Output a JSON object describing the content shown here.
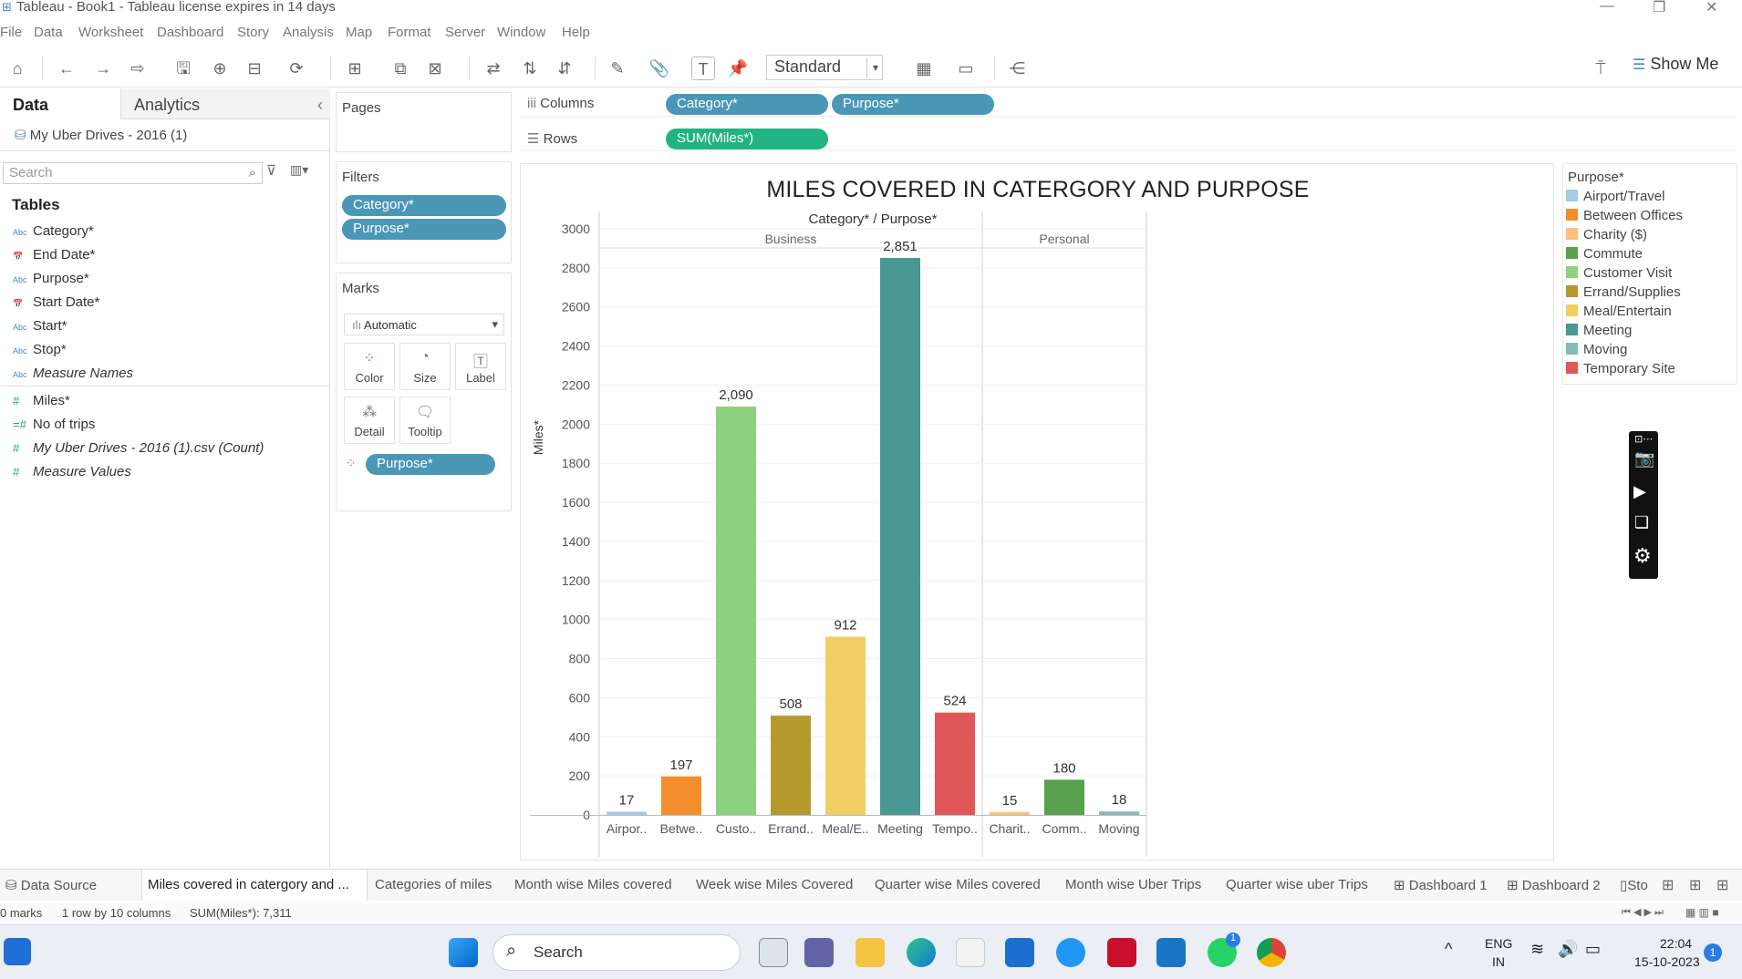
{
  "window": {
    "title": "Tableau - Book1 - Tableau license expires in 14 days"
  },
  "menu": [
    "File",
    "Data",
    "Worksheet",
    "Dashboard",
    "Story",
    "Analysis",
    "Map",
    "Format",
    "Server",
    "Window",
    "Help"
  ],
  "toolbar": {
    "fit_mode": "Standard",
    "show_me": "Show Me"
  },
  "left_pane": {
    "tabs": [
      "Data",
      "Analytics"
    ],
    "datasource": "My Uber Drives - 2016 (1)",
    "search_placeholder": "Search",
    "tables_heading": "Tables",
    "dimensions": [
      {
        "type": "Abc",
        "name": "Category*"
      },
      {
        "type": "date",
        "name": "End Date*"
      },
      {
        "type": "Abc",
        "name": "Purpose*"
      },
      {
        "type": "date",
        "name": "Start Date*"
      },
      {
        "type": "Abc",
        "name": "Start*"
      },
      {
        "type": "Abc",
        "name": "Stop*"
      },
      {
        "type": "Abc",
        "name": "Measure Names"
      }
    ],
    "measures": [
      {
        "type": "#",
        "name": "Miles*"
      },
      {
        "type": "=#",
        "name": "No of trips"
      },
      {
        "type": "#",
        "name": "My Uber Drives - 2016 (1).csv (Count)"
      },
      {
        "type": "#",
        "name": "Measure Values"
      }
    ]
  },
  "pages": {
    "title": "Pages"
  },
  "filters": {
    "title": "Filters",
    "pills": [
      "Category*",
      "Purpose*"
    ]
  },
  "marks": {
    "title": "Marks",
    "type": "Automatic",
    "buttons": [
      "Color",
      "Size",
      "Label",
      "Detail",
      "Tooltip"
    ],
    "color_pill": "Purpose*"
  },
  "shelves": {
    "columns_label": "Columns",
    "columns": [
      "Category*",
      "Purpose*"
    ],
    "rows_label": "Rows",
    "rows": [
      "SUM(Miles*)"
    ]
  },
  "chart_data": {
    "type": "bar",
    "title": "MILES COVERED IN CATERGORY AND PURPOSE",
    "header": "Category* / Purpose*",
    "ylabel": "Miles*",
    "ylim": [
      0,
      3000
    ],
    "yticks": [
      0,
      200,
      400,
      600,
      800,
      1000,
      1200,
      1400,
      1600,
      1800,
      2000,
      2200,
      2400,
      2600,
      2800,
      3000
    ],
    "groups": [
      {
        "name": "Business",
        "bars": [
          {
            "label": "Airpor..",
            "purpose": "Airport/Travel",
            "value": 17,
            "color": "#a6c9e8"
          },
          {
            "label": "Betwe..",
            "purpose": "Between Offices",
            "value": 197,
            "color": "#f28e2b"
          },
          {
            "label": "Custo..",
            "purpose": "Customer Visit",
            "value": 2090,
            "color": "#8cd17d"
          },
          {
            "label": "Errand..",
            "purpose": "Errand/Supplies",
            "value": 508,
            "color": "#b6992d"
          },
          {
            "label": "Meal/E..",
            "purpose": "Meal/Entertain",
            "value": 912,
            "color": "#f1ce63"
          },
          {
            "label": "Meeting",
            "purpose": "Meeting",
            "value": 2851,
            "color": "#499894"
          },
          {
            "label": "Tempo..",
            "purpose": "Temporary Site",
            "value": 524,
            "color": "#e15759"
          }
        ]
      },
      {
        "name": "Personal",
        "bars": [
          {
            "label": "Charit..",
            "purpose": "Charity ($)",
            "value": 15,
            "color": "#ffbe7d"
          },
          {
            "label": "Comm..",
            "purpose": "Commute",
            "value": 180,
            "color": "#59a14f"
          },
          {
            "label": "Moving",
            "purpose": "Moving",
            "value": 18,
            "color": "#86bcb6"
          }
        ]
      }
    ]
  },
  "legend": {
    "title": "Purpose*",
    "items": [
      {
        "label": "Airport/Travel",
        "color": "#a6c9e8"
      },
      {
        "label": "Between Offices",
        "color": "#f28e2b"
      },
      {
        "label": "Charity ($)",
        "color": "#ffbe7d"
      },
      {
        "label": "Commute",
        "color": "#59a14f"
      },
      {
        "label": "Customer Visit",
        "color": "#8cd17d"
      },
      {
        "label": "Errand/Supplies",
        "color": "#b6992d"
      },
      {
        "label": "Meal/Entertain",
        "color": "#f1ce63"
      },
      {
        "label": "Meeting",
        "color": "#499894"
      },
      {
        "label": "Moving",
        "color": "#86bcb6"
      },
      {
        "label": "Temporary Site",
        "color": "#e15759"
      }
    ]
  },
  "sheet_tabs": [
    "Data Source",
    "Miles covered in catergory and ...",
    "Categories of miles",
    "Month wise Miles covered",
    "Week wise Miles Covered",
    "Quarter wise Miles covered",
    "Month wise Uber Trips",
    "Quarter wise uber Trips",
    "Dashboard 1",
    "Dashboard 2",
    "Sto"
  ],
  "status": {
    "marks": "0 marks",
    "dims": "1 row by 10 columns",
    "sum": "SUM(Miles*): 7,311"
  },
  "taskbar": {
    "search": "Search",
    "lang1": "ENG",
    "lang2": "IN",
    "time": "22:04",
    "date": "15-10-2023",
    "badge": "1"
  }
}
